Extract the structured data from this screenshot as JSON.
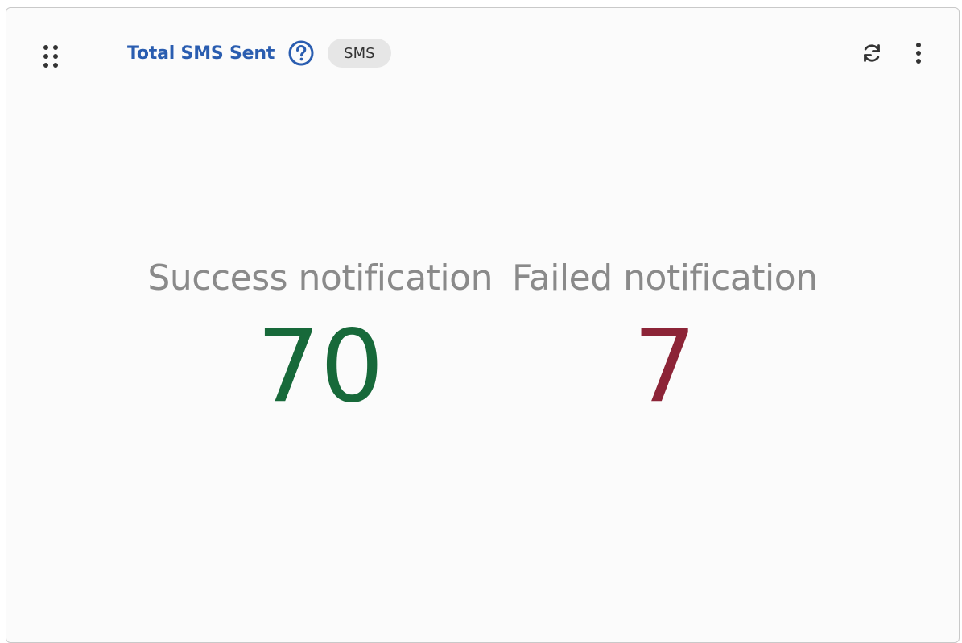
{
  "widget": {
    "title": "Total SMS Sent",
    "badge": "SMS",
    "icons": {
      "drag": "drag-handle-icon",
      "help": "help-circle-icon",
      "refresh": "refresh-icon",
      "menu": "more-vertical-icon"
    },
    "colors": {
      "title": "#2a5db0",
      "success": "#17693a",
      "failed": "#8c2437",
      "label": "#8a8a8a"
    }
  },
  "metrics": {
    "success": {
      "label": "Success notification",
      "value": "70"
    },
    "failed": {
      "label": "Failed notification",
      "value": "7"
    }
  }
}
